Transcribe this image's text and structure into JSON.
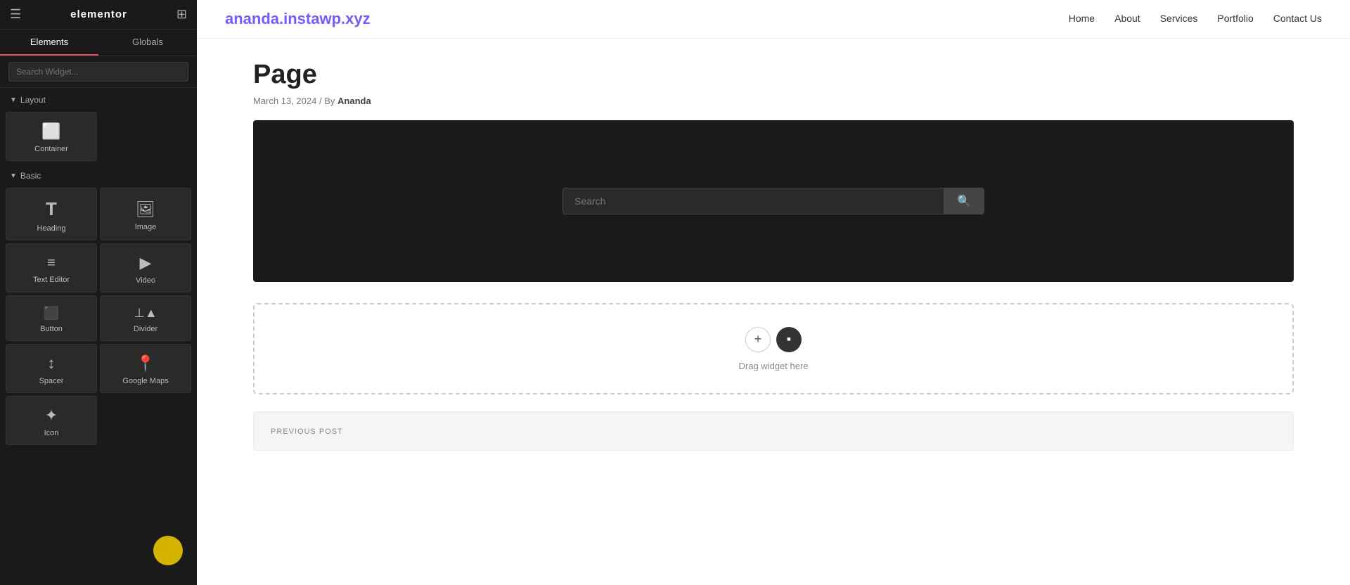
{
  "panel": {
    "logo": "elementor",
    "tabs": [
      {
        "label": "Elements",
        "active": true
      },
      {
        "label": "Globals",
        "active": false
      }
    ],
    "search_placeholder": "Search Widget...",
    "sections": {
      "layout": {
        "label": "Layout",
        "widgets": [
          {
            "id": "container",
            "label": "Container",
            "icon": "⬜"
          }
        ]
      },
      "basic": {
        "label": "Basic",
        "widgets": [
          {
            "id": "heading",
            "label": "Heading",
            "icon": "T"
          },
          {
            "id": "image",
            "label": "Image",
            "icon": "🖼"
          },
          {
            "id": "text-editor",
            "label": "Text Editor",
            "icon": "≡"
          },
          {
            "id": "video",
            "label": "Video",
            "icon": "▶"
          },
          {
            "id": "button",
            "label": "Button",
            "icon": "⬜"
          },
          {
            "id": "divider",
            "label": "Divider",
            "icon": "÷"
          },
          {
            "id": "spacer",
            "label": "Spacer",
            "icon": "↕"
          },
          {
            "id": "google-maps",
            "label": "Google Maps",
            "icon": "📍"
          },
          {
            "id": "icon",
            "label": "Icon",
            "icon": "✦"
          }
        ]
      }
    }
  },
  "site": {
    "domain": "ananda.instawp.xyz",
    "nav": [
      {
        "label": "Home",
        "href": "#"
      },
      {
        "label": "About",
        "href": "#"
      },
      {
        "label": "Services",
        "href": "#"
      },
      {
        "label": "Portfolio",
        "href": "#"
      },
      {
        "label": "Contact Us",
        "href": "#"
      }
    ]
  },
  "page": {
    "title": "Page",
    "date": "March 13, 2024",
    "author": "Ananda",
    "meta_separator": "/",
    "by_label": "By"
  },
  "dark_section": {
    "search_placeholder": "Search"
  },
  "drop_zone": {
    "label": "Drag widget here"
  },
  "prev_post": {
    "label": "PREVIOUS POST"
  },
  "toolbar": {
    "collapse_label": "‹"
  }
}
